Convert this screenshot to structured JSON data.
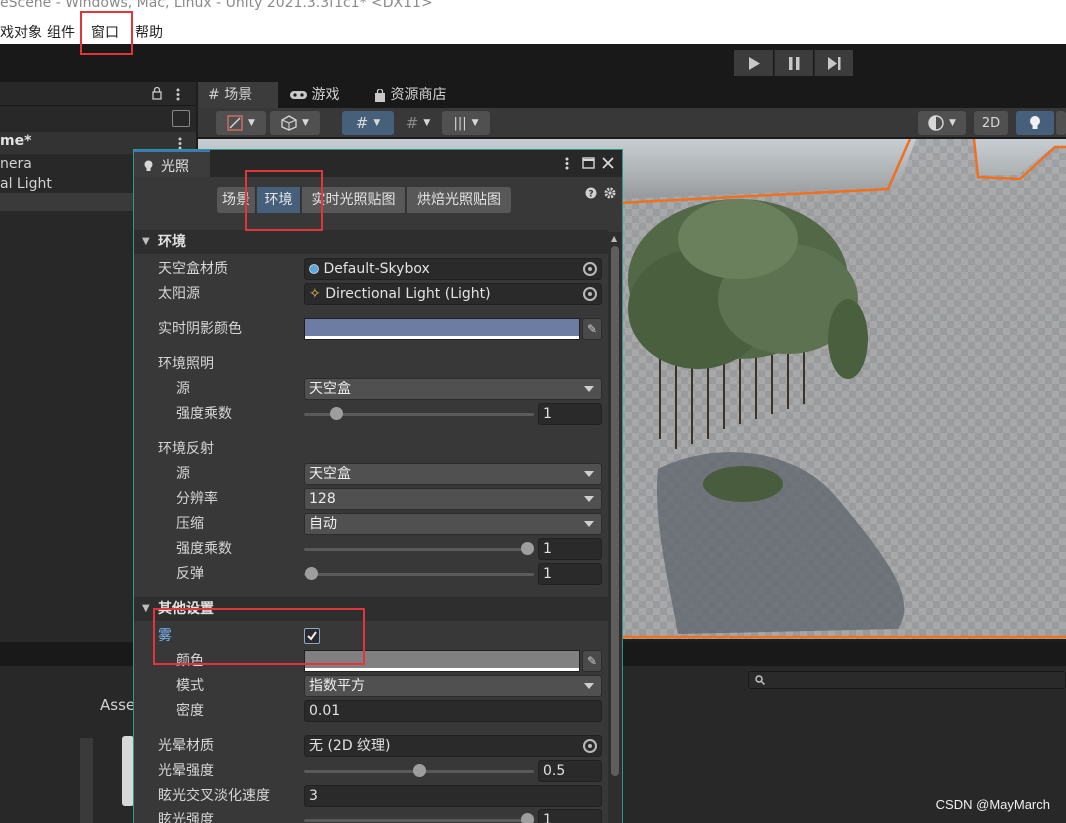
{
  "window": {
    "title": "eScene - Windows, Mac, Linux - Unity 2021.3.3f1c1* <DX11>"
  },
  "menu": {
    "items": [
      "戏对象",
      "组件",
      "窗口",
      "帮助"
    ]
  },
  "hierarchy": {
    "rows": [
      "me*",
      "nera",
      "al Light"
    ]
  },
  "scene_tabs": [
    {
      "label": "场景",
      "icon": "grid-icon"
    },
    {
      "label": "游戏",
      "icon": "gamepad-icon"
    },
    {
      "label": "资源商店",
      "icon": "store-bag-icon"
    }
  ],
  "scene_toolbar": {
    "mode_2d": "2D"
  },
  "lighting": {
    "title": "光照",
    "tabs": [
      "场景",
      "环境",
      "实时光照贴图",
      "烘焙光照贴图"
    ],
    "active_tab": "环境",
    "environment": {
      "header": "环境",
      "skybox_label": "天空盒材质",
      "skybox_value": "Default-Skybox",
      "sun_label": "太阳源",
      "sun_value": "Directional Light (Light)",
      "shadow_color_label": "实时阴影颜色",
      "shadow_color": "#6c7ca3",
      "ambient": {
        "header": "环境照明",
        "source_label": "源",
        "source_value": "天空盒",
        "intensity_label": "强度乘数",
        "intensity_value": "1",
        "intensity_fraction": 0.14
      },
      "reflections": {
        "header": "环境反射",
        "source_label": "源",
        "source_value": "天空盒",
        "resolution_label": "分辨率",
        "resolution_value": "128",
        "compression_label": "压缩",
        "compression_value": "自动",
        "intensity_label": "强度乘数",
        "intensity_value": "1",
        "intensity_fraction": 0.97,
        "bounces_label": "反弹",
        "bounces_value": "1",
        "bounces_fraction": 0.03
      }
    },
    "other": {
      "header": "其他设置",
      "fog_label": "雾",
      "fog_enabled": true,
      "fog_color_label": "颜色",
      "fog_color": "#808080",
      "fog_mode_label": "模式",
      "fog_mode_value": "指数平方",
      "fog_density_label": "密度",
      "fog_density_value": "0.01",
      "halo_label": "光晕材质",
      "halo_value": "无 (2D 纹理)",
      "halo_strength_label": "光晕强度",
      "halo_strength_value": "0.5",
      "halo_strength_fraction": 0.5,
      "flare_fade_label": "眩光交叉淡化速度",
      "flare_fade_value": "3",
      "flare_strength_label": "眩光强度",
      "flare_strength_value": "1"
    }
  },
  "assets": {
    "tab": "Asse"
  },
  "watermark": "CSDN @MayMarch"
}
